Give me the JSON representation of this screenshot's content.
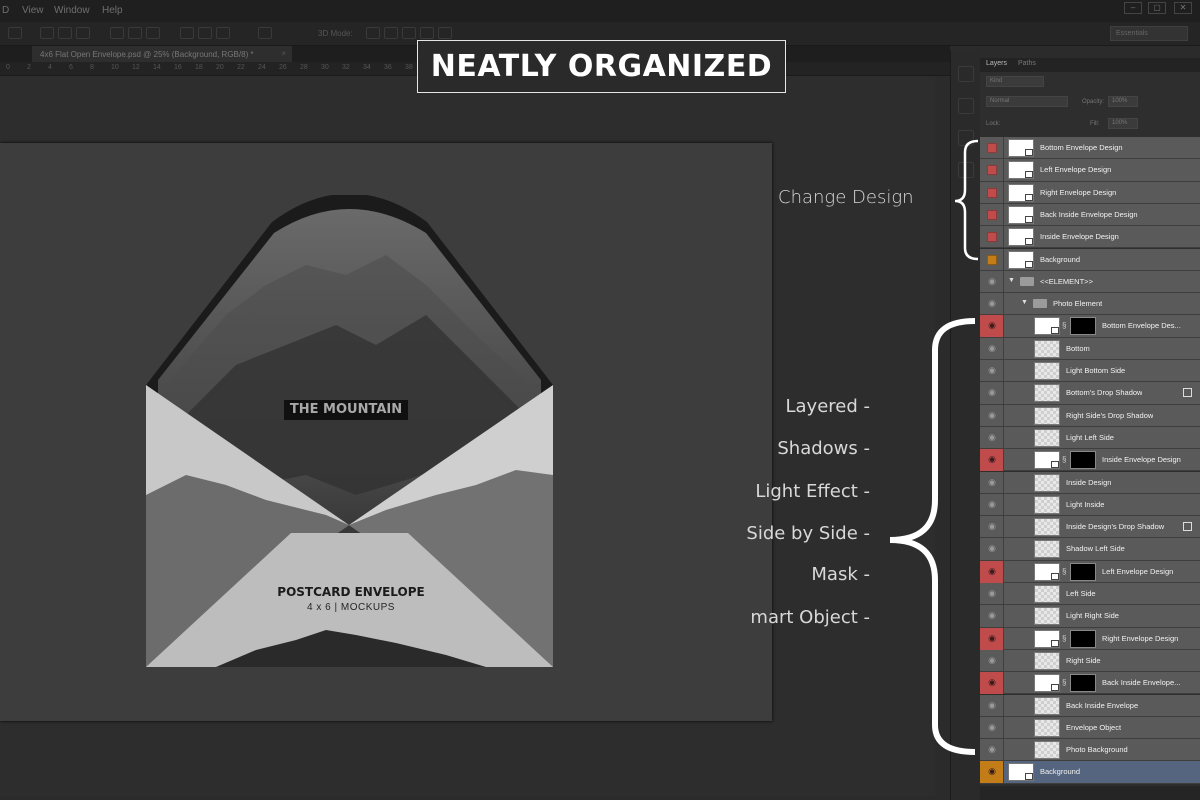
{
  "menu": [
    "D",
    "View",
    "Window",
    "Help"
  ],
  "window_controls": [
    "–",
    "▢",
    "✕"
  ],
  "options_bar": {
    "mode_label": "3D Mode:",
    "workspace": "Essentials"
  },
  "document_tab": {
    "title": "4x6 Flat Open Envelope.psd @ 25% (Background, RGB/8) *",
    "close": "×"
  },
  "ruler_ticks": [
    "0",
    "2",
    "4",
    "6",
    "8",
    "10",
    "12",
    "14",
    "16",
    "18",
    "20",
    "22",
    "24",
    "26",
    "28",
    "30",
    "32",
    "34",
    "36",
    "38",
    "40",
    "42",
    "44"
  ],
  "headline": "NEATLY ORGANIZED",
  "artwork": {
    "mountain_title": "THE MOUNTAIN",
    "product_title": "POSTCARD ENVELOPE",
    "product_sub": "4 x 6 | MOCKUPS"
  },
  "annotations": {
    "change_design": "Change Design",
    "features": [
      "Layered -",
      "Shadows -",
      "Light Effect -",
      "Side by Side -",
      "Mask -",
      "mart Object -"
    ]
  },
  "panel": {
    "tabs": [
      "Layers",
      "Paths"
    ],
    "kind": "Kind",
    "blend_mode": "Normal",
    "opacity_label": "Opacity:",
    "opacity_value": "100%",
    "lock_label": "Lock:",
    "fill_label": "Fill:",
    "fill_value": "100%"
  },
  "layers": [
    {
      "name": "Bottom Envelope Design",
      "eye": "red-box",
      "indent": 0,
      "thumb": "white",
      "so": true
    },
    {
      "name": "Left Envelope Design",
      "eye": "red-box",
      "indent": 0,
      "thumb": "white",
      "so": true
    },
    {
      "name": "Right Envelope Design",
      "eye": "red-box",
      "indent": 0,
      "thumb": "white",
      "so": true
    },
    {
      "name": "Back Inside Envelope Design",
      "eye": "red-box",
      "indent": 0,
      "thumb": "white",
      "so": true
    },
    {
      "name": "Inside Envelope Design",
      "eye": "red-box",
      "indent": 0,
      "thumb": "white",
      "so": true
    },
    {
      "name": "Background",
      "eye": "orange-box",
      "indent": 0,
      "thumb": "white",
      "so": true
    },
    {
      "name": "<<ELEMENT>>",
      "eye": "eye",
      "indent": 0,
      "type": "group"
    },
    {
      "name": "Photo Element",
      "eye": "eye",
      "indent": 1,
      "type": "group"
    },
    {
      "name": "Bottom Envelope Des...",
      "eye": "red-eye",
      "indent": 2,
      "thumb": "white",
      "so": true,
      "mask": true
    },
    {
      "name": "Bottom",
      "eye": "eye",
      "indent": 2,
      "thumb": "chk"
    },
    {
      "name": "Light Bottom Side",
      "eye": "eye",
      "indent": 2,
      "thumb": "chk"
    },
    {
      "name": "Bottom's Drop Shadow",
      "eye": "eye",
      "indent": 2,
      "thumb": "chk",
      "fx": true
    },
    {
      "name": "Right Side's Drop Shadow",
      "eye": "eye",
      "indent": 2,
      "thumb": "chk"
    },
    {
      "name": "Light Left Side",
      "eye": "eye",
      "indent": 2,
      "thumb": "chk"
    },
    {
      "name": "Inside Envelope Design",
      "eye": "red-eye",
      "indent": 2,
      "thumb": "white",
      "so": true,
      "mask": true
    },
    {
      "name": "Inside Design",
      "eye": "eye",
      "indent": 2,
      "thumb": "chk"
    },
    {
      "name": "Light Inside",
      "eye": "eye",
      "indent": 2,
      "thumb": "chk"
    },
    {
      "name": "Inside Design's Drop Shadow",
      "eye": "eye",
      "indent": 2,
      "thumb": "chk",
      "fx": true
    },
    {
      "name": "Shadow Left Side",
      "eye": "eye",
      "indent": 2,
      "thumb": "chk"
    },
    {
      "name": "Left Envelope Design",
      "eye": "red-eye",
      "indent": 2,
      "thumb": "white",
      "so": true,
      "mask": true
    },
    {
      "name": "Left Side",
      "eye": "eye",
      "indent": 2,
      "thumb": "chk"
    },
    {
      "name": "Light Right Side",
      "eye": "eye",
      "indent": 2,
      "thumb": "chk"
    },
    {
      "name": "Right Envelope Design",
      "eye": "red-eye",
      "indent": 2,
      "thumb": "white",
      "so": true,
      "mask": true
    },
    {
      "name": "Right Side",
      "eye": "eye",
      "indent": 2,
      "thumb": "chk"
    },
    {
      "name": "Back Inside Envelope...",
      "eye": "red-eye",
      "indent": 2,
      "thumb": "white",
      "so": true,
      "mask": true
    },
    {
      "name": "Back Inside Envelope",
      "eye": "eye",
      "indent": 2,
      "thumb": "chk"
    },
    {
      "name": "Envelope Object",
      "eye": "eye",
      "indent": 2,
      "thumb": "chk"
    },
    {
      "name": "Photo Background",
      "eye": "eye",
      "indent": 2,
      "thumb": "chk"
    },
    {
      "name": "Background",
      "eye": "orange-eye",
      "indent": 0,
      "thumb": "white",
      "so": true,
      "selected": true
    }
  ],
  "colors": {
    "red": "#c04b4b",
    "orange": "#c27d18",
    "selected": "#55657f"
  }
}
